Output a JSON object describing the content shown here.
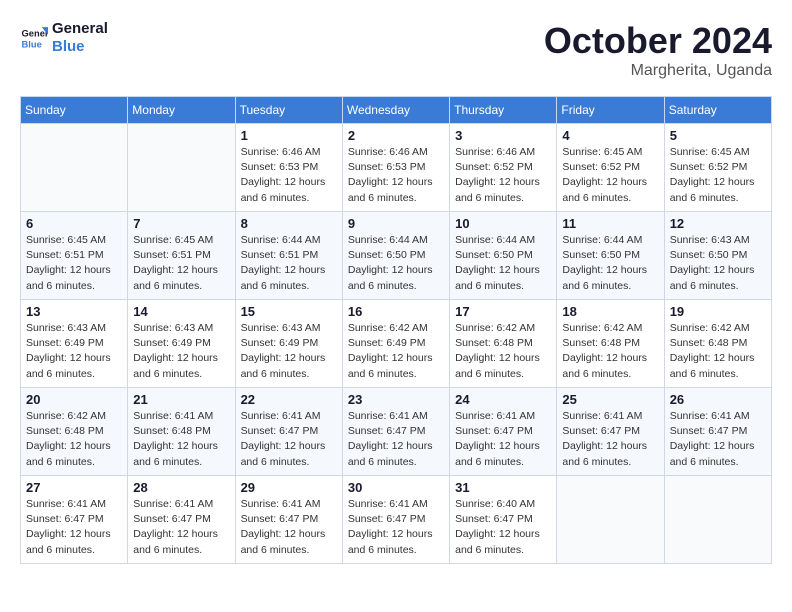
{
  "logo": {
    "line1": "General",
    "line2": "Blue"
  },
  "header": {
    "month": "October 2024",
    "location": "Margherita, Uganda"
  },
  "weekdays": [
    "Sunday",
    "Monday",
    "Tuesday",
    "Wednesday",
    "Thursday",
    "Friday",
    "Saturday"
  ],
  "weeks": [
    [
      {
        "day": "",
        "info": ""
      },
      {
        "day": "",
        "info": ""
      },
      {
        "day": "1",
        "info": "Sunrise: 6:46 AM\nSunset: 6:53 PM\nDaylight: 12 hours and 6 minutes."
      },
      {
        "day": "2",
        "info": "Sunrise: 6:46 AM\nSunset: 6:53 PM\nDaylight: 12 hours and 6 minutes."
      },
      {
        "day": "3",
        "info": "Sunrise: 6:46 AM\nSunset: 6:52 PM\nDaylight: 12 hours and 6 minutes."
      },
      {
        "day": "4",
        "info": "Sunrise: 6:45 AM\nSunset: 6:52 PM\nDaylight: 12 hours and 6 minutes."
      },
      {
        "day": "5",
        "info": "Sunrise: 6:45 AM\nSunset: 6:52 PM\nDaylight: 12 hours and 6 minutes."
      }
    ],
    [
      {
        "day": "6",
        "info": "Sunrise: 6:45 AM\nSunset: 6:51 PM\nDaylight: 12 hours and 6 minutes."
      },
      {
        "day": "7",
        "info": "Sunrise: 6:45 AM\nSunset: 6:51 PM\nDaylight: 12 hours and 6 minutes."
      },
      {
        "day": "8",
        "info": "Sunrise: 6:44 AM\nSunset: 6:51 PM\nDaylight: 12 hours and 6 minutes."
      },
      {
        "day": "9",
        "info": "Sunrise: 6:44 AM\nSunset: 6:50 PM\nDaylight: 12 hours and 6 minutes."
      },
      {
        "day": "10",
        "info": "Sunrise: 6:44 AM\nSunset: 6:50 PM\nDaylight: 12 hours and 6 minutes."
      },
      {
        "day": "11",
        "info": "Sunrise: 6:44 AM\nSunset: 6:50 PM\nDaylight: 12 hours and 6 minutes."
      },
      {
        "day": "12",
        "info": "Sunrise: 6:43 AM\nSunset: 6:50 PM\nDaylight: 12 hours and 6 minutes."
      }
    ],
    [
      {
        "day": "13",
        "info": "Sunrise: 6:43 AM\nSunset: 6:49 PM\nDaylight: 12 hours and 6 minutes."
      },
      {
        "day": "14",
        "info": "Sunrise: 6:43 AM\nSunset: 6:49 PM\nDaylight: 12 hours and 6 minutes."
      },
      {
        "day": "15",
        "info": "Sunrise: 6:43 AM\nSunset: 6:49 PM\nDaylight: 12 hours and 6 minutes."
      },
      {
        "day": "16",
        "info": "Sunrise: 6:42 AM\nSunset: 6:49 PM\nDaylight: 12 hours and 6 minutes."
      },
      {
        "day": "17",
        "info": "Sunrise: 6:42 AM\nSunset: 6:48 PM\nDaylight: 12 hours and 6 minutes."
      },
      {
        "day": "18",
        "info": "Sunrise: 6:42 AM\nSunset: 6:48 PM\nDaylight: 12 hours and 6 minutes."
      },
      {
        "day": "19",
        "info": "Sunrise: 6:42 AM\nSunset: 6:48 PM\nDaylight: 12 hours and 6 minutes."
      }
    ],
    [
      {
        "day": "20",
        "info": "Sunrise: 6:42 AM\nSunset: 6:48 PM\nDaylight: 12 hours and 6 minutes."
      },
      {
        "day": "21",
        "info": "Sunrise: 6:41 AM\nSunset: 6:48 PM\nDaylight: 12 hours and 6 minutes."
      },
      {
        "day": "22",
        "info": "Sunrise: 6:41 AM\nSunset: 6:47 PM\nDaylight: 12 hours and 6 minutes."
      },
      {
        "day": "23",
        "info": "Sunrise: 6:41 AM\nSunset: 6:47 PM\nDaylight: 12 hours and 6 minutes."
      },
      {
        "day": "24",
        "info": "Sunrise: 6:41 AM\nSunset: 6:47 PM\nDaylight: 12 hours and 6 minutes."
      },
      {
        "day": "25",
        "info": "Sunrise: 6:41 AM\nSunset: 6:47 PM\nDaylight: 12 hours and 6 minutes."
      },
      {
        "day": "26",
        "info": "Sunrise: 6:41 AM\nSunset: 6:47 PM\nDaylight: 12 hours and 6 minutes."
      }
    ],
    [
      {
        "day": "27",
        "info": "Sunrise: 6:41 AM\nSunset: 6:47 PM\nDaylight: 12 hours and 6 minutes."
      },
      {
        "day": "28",
        "info": "Sunrise: 6:41 AM\nSunset: 6:47 PM\nDaylight: 12 hours and 6 minutes."
      },
      {
        "day": "29",
        "info": "Sunrise: 6:41 AM\nSunset: 6:47 PM\nDaylight: 12 hours and 6 minutes."
      },
      {
        "day": "30",
        "info": "Sunrise: 6:41 AM\nSunset: 6:47 PM\nDaylight: 12 hours and 6 minutes."
      },
      {
        "day": "31",
        "info": "Sunrise: 6:40 AM\nSunset: 6:47 PM\nDaylight: 12 hours and 6 minutes."
      },
      {
        "day": "",
        "info": ""
      },
      {
        "day": "",
        "info": ""
      }
    ]
  ]
}
